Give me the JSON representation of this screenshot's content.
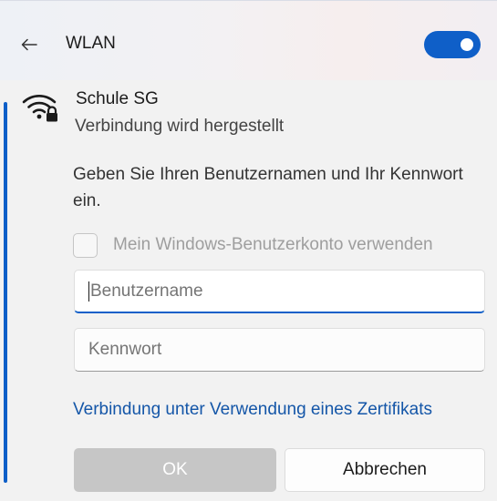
{
  "header": {
    "title": "WLAN",
    "back_icon": "arrow-left-icon",
    "wifi_toggle": {
      "state": "on",
      "color": "#0f5fc8"
    }
  },
  "network": {
    "icon": "wifi-secured-icon",
    "name": "Schule SG",
    "status": "Verbindung wird hergestellt"
  },
  "form": {
    "instructions": "Geben Sie Ihren Benutzernamen und Ihr Kennwort ein.",
    "use_windows_account_label": "Mein Windows-Benutzerkonto verwenden",
    "use_windows_account_checked": false,
    "username_placeholder": "Benutzername",
    "username_value": "",
    "password_placeholder": "Kennwort",
    "password_value": "",
    "certificate_link": "Verbindung unter Verwendung eines Zertifikats",
    "ok_label": "OK",
    "cancel_label": "Abbrechen"
  },
  "colors": {
    "accent": "#0f5fc8",
    "link": "#1456a8",
    "disabled_button": "#c6c6c6"
  }
}
